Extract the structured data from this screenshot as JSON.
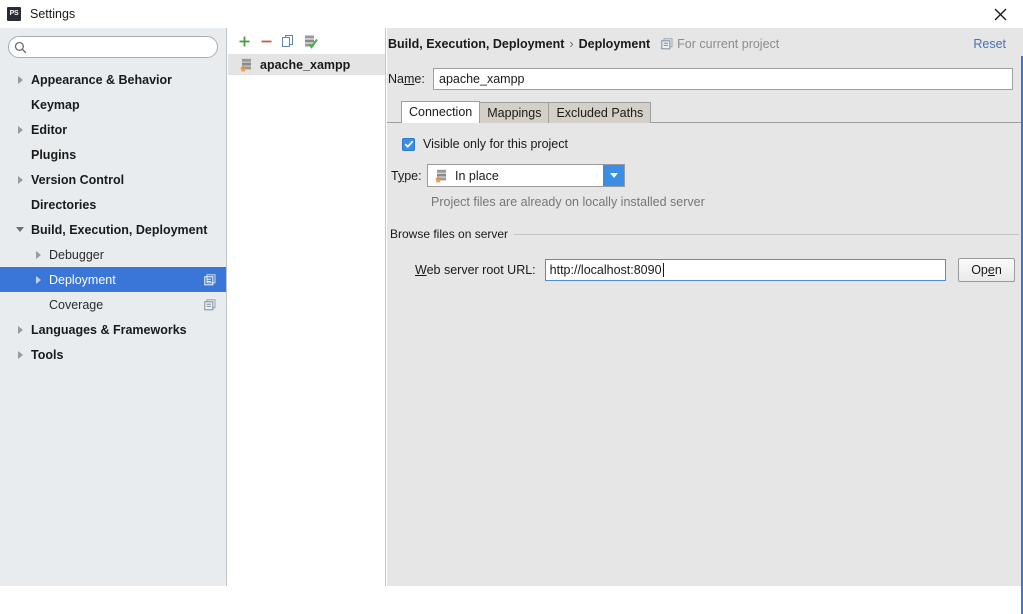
{
  "window": {
    "title": "Settings",
    "app_icon": "phpstorm-logo-icon",
    "close_label": "✕"
  },
  "sidebar": {
    "search": {
      "value": "",
      "placeholder": "",
      "icon": "search-icon"
    },
    "items": [
      {
        "label": "Appearance & Behavior",
        "level": 0,
        "arrow": "right",
        "selected": false,
        "badge": false
      },
      {
        "label": "Keymap",
        "level": 0,
        "arrow": "none",
        "selected": false,
        "badge": false
      },
      {
        "label": "Editor",
        "level": 0,
        "arrow": "right",
        "selected": false,
        "badge": false
      },
      {
        "label": "Plugins",
        "level": 0,
        "arrow": "none",
        "selected": false,
        "badge": false
      },
      {
        "label": "Version Control",
        "level": 0,
        "arrow": "right",
        "selected": false,
        "badge": false
      },
      {
        "label": "Directories",
        "level": 0,
        "arrow": "none",
        "selected": false,
        "badge": false
      },
      {
        "label": "Build, Execution, Deployment",
        "level": 0,
        "arrow": "down",
        "selected": false,
        "badge": false
      },
      {
        "label": "Debugger",
        "level": 1,
        "arrow": "right",
        "selected": false,
        "badge": false
      },
      {
        "label": "Deployment",
        "level": 1,
        "arrow": "right",
        "selected": true,
        "badge": true
      },
      {
        "label": "Coverage",
        "level": 1,
        "arrow": "none",
        "selected": false,
        "badge": true
      },
      {
        "label": "Languages & Frameworks",
        "level": 0,
        "arrow": "right",
        "selected": false,
        "badge": false
      },
      {
        "label": "Tools",
        "level": 0,
        "arrow": "right",
        "selected": false,
        "badge": false
      }
    ]
  },
  "server_list": {
    "toolbar": [
      {
        "name": "add-server-button",
        "icon": "plus-icon",
        "title": "Add"
      },
      {
        "name": "remove-server-button",
        "icon": "minus-icon",
        "title": "Remove"
      },
      {
        "name": "copy-server-button",
        "icon": "copy-icon",
        "title": "Copy"
      },
      {
        "name": "set-default-server-button",
        "icon": "server-check-icon",
        "title": "Use as default"
      }
    ],
    "items": [
      {
        "label": "apache_xampp",
        "icon": "server-icon",
        "selected": true
      }
    ]
  },
  "right_panel": {
    "breadcrumb": {
      "root": "Build, Execution, Deployment",
      "separator": "›",
      "current": "Deployment",
      "scope_icon": "project-scope-icon",
      "scope_text": "For current project"
    },
    "reset_label": "Reset",
    "name_field": {
      "label_pre": "Na",
      "label_mnemonic": "m",
      "label_post": "e:",
      "value": "apache_xampp"
    },
    "tabs": [
      {
        "label": "Connection",
        "active": true
      },
      {
        "label": "Mappings",
        "active": false
      },
      {
        "label": "Excluded Paths",
        "active": false
      }
    ],
    "connection": {
      "visible_only_checkbox": {
        "label": "Visible only for this project",
        "checked": true
      },
      "type": {
        "label_pre": "T",
        "label_mnemonic": "y",
        "label_post": "pe:",
        "value": "In place",
        "icon": "server-icon",
        "hint": "Project files are already on locally installed server"
      },
      "browse_group": {
        "title": "Browse files on server",
        "url_label_pre": "",
        "url_label_mnemonic": "W",
        "url_label_post": "eb server root URL:",
        "url_value": "http://localhost:8090",
        "open_button_pre": "Op",
        "open_button_mnemonic": "e",
        "open_button_post": "n"
      }
    }
  },
  "colors": {
    "selection_blue": "#3a76d8",
    "accent_blue": "#3a8ee6",
    "link_blue": "#4a6fb5",
    "sidebar_bg": "#e8ecef",
    "panel_bg": "#e6e6e6",
    "field_focus_border": "#4a90d9"
  }
}
